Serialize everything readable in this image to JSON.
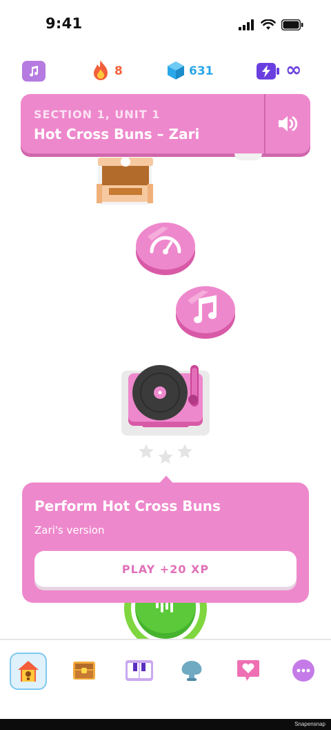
{
  "status_bar": {
    "time": "9:41"
  },
  "stats": {
    "streak": "8",
    "gems": "631",
    "energy": "∞"
  },
  "banner": {
    "section": "SECTION 1, UNIT 1",
    "title": "Hot Cross Buns – Zari"
  },
  "nodes": [
    {
      "type": "treasure-chest",
      "state": "locked"
    },
    {
      "type": "speed-practice",
      "state": "active"
    },
    {
      "type": "song",
      "state": "active"
    },
    {
      "type": "record-player",
      "state": "current",
      "stars": 3
    }
  ],
  "popover": {
    "title": "Perform Hot Cross Buns",
    "subtitle": "Zari's version",
    "button": "PLAY +20 XP"
  },
  "tabs": [
    {
      "icon": "home-birdhouse-icon",
      "active": true
    },
    {
      "icon": "treasure-chest-icon",
      "active": false
    },
    {
      "icon": "piano-keys-icon",
      "active": false
    },
    {
      "icon": "shell-icon",
      "active": false
    },
    {
      "icon": "heart-chat-icon",
      "active": false
    },
    {
      "icon": "more-icon",
      "active": false
    }
  ],
  "watermark": "Snapensnap",
  "colors": {
    "accent_pink": "#ee88cc",
    "streak": "#f25f3a",
    "gems": "#2aa7e8",
    "energy": "#6a3fe0",
    "music_chip": "#b57be0"
  }
}
